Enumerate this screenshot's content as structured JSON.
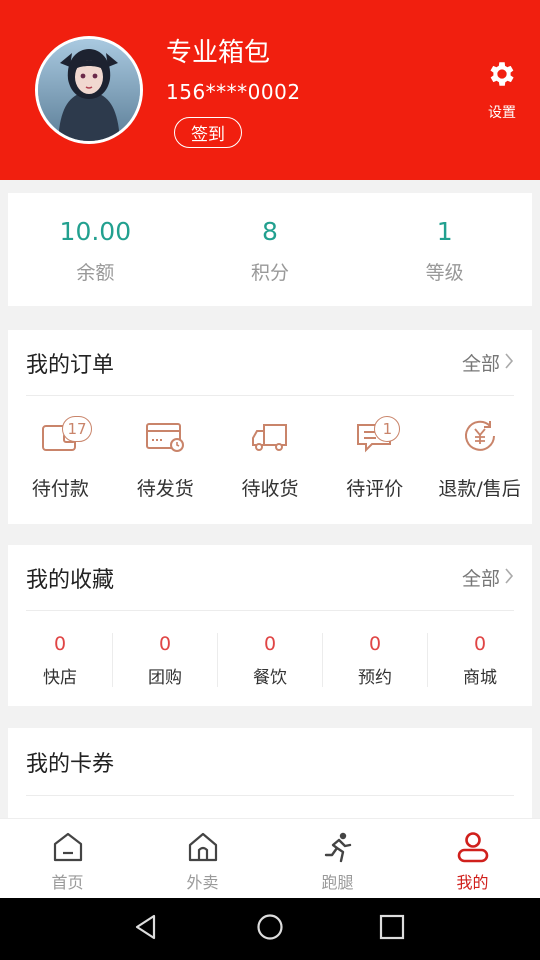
{
  "profile": {
    "name": "专业箱包",
    "phone": "156****0002",
    "checkin_label": "签到",
    "settings_label": "设置"
  },
  "stats": [
    {
      "value": "10.00",
      "label": "余额"
    },
    {
      "value": "8",
      "label": "积分"
    },
    {
      "value": "1",
      "label": "等级"
    }
  ],
  "orders": {
    "title": "我的订单",
    "more_label": "全部",
    "items": [
      {
        "label": "待付款",
        "icon": "wallet-icon",
        "badge": "17"
      },
      {
        "label": "待发货",
        "icon": "card-clock-icon",
        "badge": null
      },
      {
        "label": "待收货",
        "icon": "truck-icon",
        "badge": null
      },
      {
        "label": "待评价",
        "icon": "comment-icon",
        "badge": "1"
      },
      {
        "label": "退款/售后",
        "icon": "yuan-refund-icon",
        "badge": null
      }
    ]
  },
  "favorites": {
    "title": "我的收藏",
    "more_label": "全部",
    "items": [
      {
        "count": "0",
        "label": "快店"
      },
      {
        "count": "0",
        "label": "团购"
      },
      {
        "count": "0",
        "label": "餐饮"
      },
      {
        "count": "0",
        "label": "预约"
      },
      {
        "count": "0",
        "label": "商城"
      }
    ]
  },
  "coupons": {
    "title": "我的卡券"
  },
  "tabbar": [
    {
      "label": "首页",
      "icon": "home-icon",
      "active": false
    },
    {
      "label": "外卖",
      "icon": "store-icon",
      "active": false
    },
    {
      "label": "跑腿",
      "icon": "runner-icon",
      "active": false
    },
    {
      "label": "我的",
      "icon": "user-icon",
      "active": true
    }
  ],
  "colors": {
    "header_red": "#f11f0f",
    "accent_teal": "#22a08f",
    "badge_brown": "#c9846a",
    "fav_count_red": "#e04545",
    "tab_active": "#d0201c"
  }
}
